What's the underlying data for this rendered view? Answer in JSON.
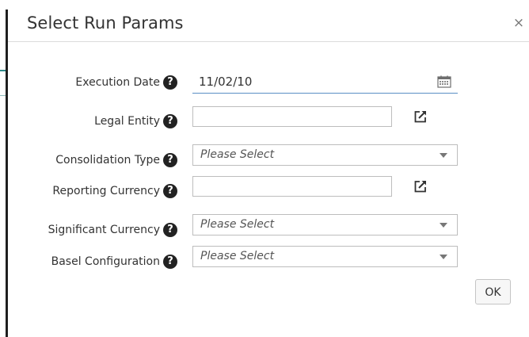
{
  "dialog": {
    "title": "Select Run Params",
    "close_glyph": "×",
    "ok_label": "OK"
  },
  "fields": {
    "execution_date": {
      "label": "Execution Date",
      "value": "11/02/10",
      "icon": "calendar-icon"
    },
    "legal_entity": {
      "label": "Legal Entity",
      "value": "",
      "icon": "launch-icon"
    },
    "consolidation_type": {
      "label": "Consolidation Type",
      "placeholder": "Please Select"
    },
    "reporting_currency": {
      "label": "Reporting Currency",
      "value": "",
      "icon": "launch-icon"
    },
    "significant_currency": {
      "label": "Significant Currency",
      "placeholder": "Please Select"
    },
    "basel_configuration": {
      "label": "Basel Configuration",
      "placeholder": "Please Select"
    }
  },
  "help_glyph": "?",
  "colors": {
    "date_underline": "#5a8fc4",
    "help_icon": "#222222",
    "border": "#bdbdbd"
  }
}
